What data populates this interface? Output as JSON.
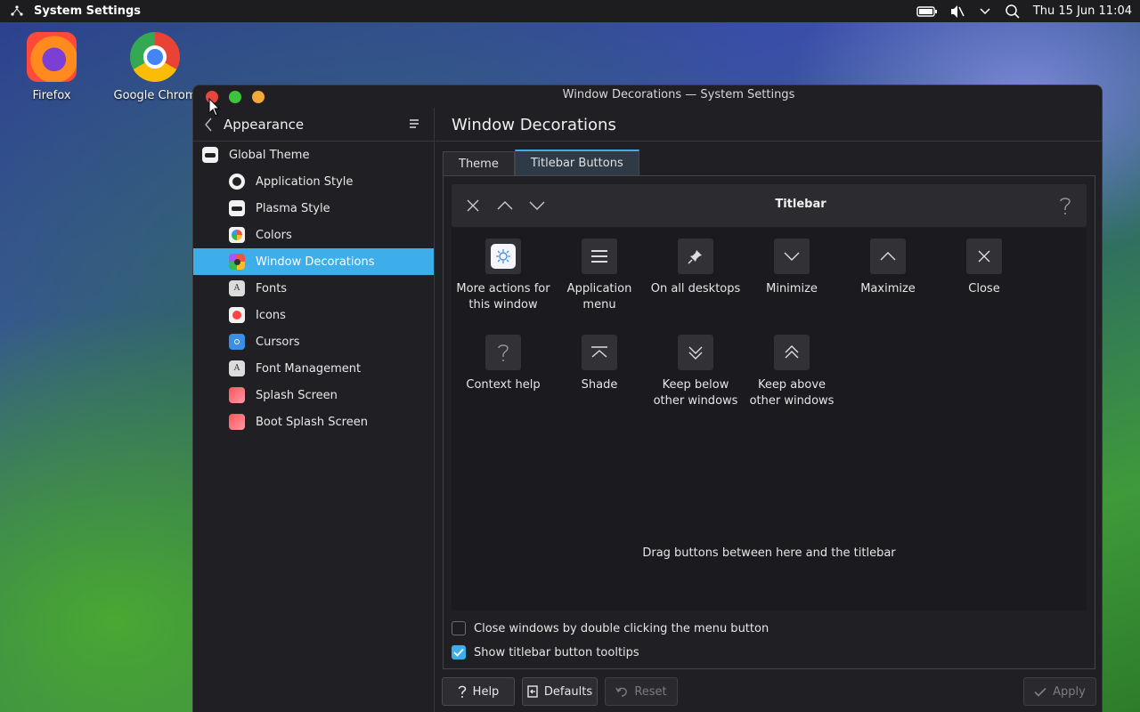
{
  "panel": {
    "app_name": "System Settings",
    "clock": "Thu 15 Jun 11:04"
  },
  "desktop": [
    {
      "label": "Firefox",
      "icon": "firefox-icon"
    },
    {
      "label": "Google Chrom",
      "icon": "chrome-icon"
    }
  ],
  "window": {
    "title": "Window Decorations — System Settings"
  },
  "sidebar": {
    "title": "Appearance",
    "items": [
      {
        "label": "Global Theme",
        "icon": "global-theme-icon"
      },
      {
        "label": "Application Style",
        "icon": "application-style-icon"
      },
      {
        "label": "Plasma Style",
        "icon": "plasma-style-icon"
      },
      {
        "label": "Colors",
        "icon": "colors-icon"
      },
      {
        "label": "Window Decorations",
        "icon": "window-decorations-icon"
      },
      {
        "label": "Fonts",
        "icon": "fonts-icon"
      },
      {
        "label": "Icons",
        "icon": "icons-icon"
      },
      {
        "label": "Cursors",
        "icon": "cursors-icon"
      },
      {
        "label": "Font Management",
        "icon": "font-management-icon"
      },
      {
        "label": "Splash Screen",
        "icon": "splash-screen-icon"
      },
      {
        "label": "Boot Splash Screen",
        "icon": "boot-splash-screen-icon"
      }
    ],
    "active_index": 4
  },
  "content": {
    "title": "Window Decorations",
    "tabs": [
      {
        "label": "Theme"
      },
      {
        "label": "Titlebar Buttons"
      }
    ],
    "active_tab": 1,
    "titlebar_preview": {
      "title": "Titlebar"
    },
    "buttons": [
      {
        "label": "More actions for this window",
        "icon": "more-actions-icon"
      },
      {
        "label": "Application menu",
        "icon": "application-menu-icon"
      },
      {
        "label": "On all desktops",
        "icon": "pin-icon"
      },
      {
        "label": "Minimize",
        "icon": "minimize-icon"
      },
      {
        "label": "Maximize",
        "icon": "maximize-icon"
      },
      {
        "label": "Close",
        "icon": "close-icon"
      },
      {
        "label": "Context help",
        "icon": "context-help-icon"
      },
      {
        "label": "Shade",
        "icon": "shade-icon"
      },
      {
        "label": "Keep below other windows",
        "icon": "keep-below-icon"
      },
      {
        "label": "Keep above other windows",
        "icon": "keep-above-icon"
      }
    ],
    "drag_hint": "Drag buttons between here and the titlebar",
    "options": [
      {
        "label": "Close windows by double clicking the menu button",
        "checked": false
      },
      {
        "label": "Show titlebar button tooltips",
        "checked": true
      }
    ]
  },
  "footer": {
    "help": "Help",
    "defaults": "Defaults",
    "reset": "Reset",
    "apply": "Apply"
  },
  "colors": {
    "accent": "#3daee9",
    "close": "#e8463d",
    "maximize": "#3cc43c",
    "minimize": "#f1a93a"
  }
}
